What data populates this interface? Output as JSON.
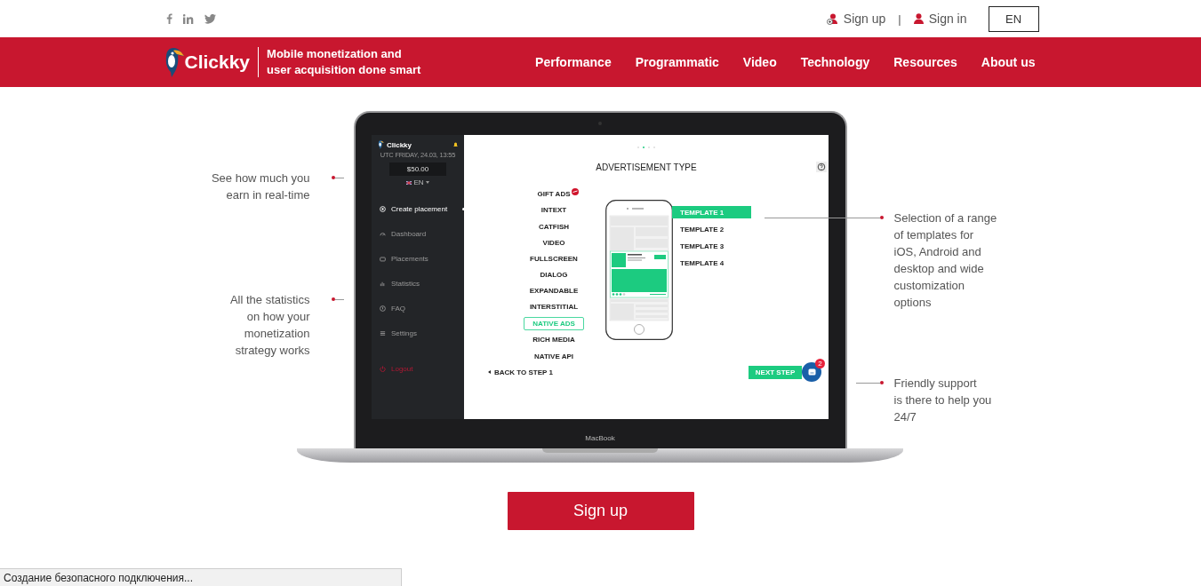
{
  "top_bar": {
    "sign_up": "Sign up",
    "separator": "|",
    "sign_in": "Sign in",
    "language": "EN"
  },
  "header": {
    "logo": "Clickky",
    "tagline": [
      "Mobile monetization and",
      "user acquisition done smart"
    ],
    "nav": [
      "Performance",
      "Programmatic",
      "Video",
      "Technology",
      "Resources",
      "About us"
    ]
  },
  "app_screen": {
    "logo": "Clickky",
    "datetime": "UTC FRIDAY, 24.03, 13:55",
    "balance": "$50.00",
    "language": "EN",
    "menu": [
      {
        "label": "Create placement",
        "selected": true,
        "kind": "item"
      },
      {
        "label": "Dashboard",
        "selected": false,
        "kind": "item"
      },
      {
        "label": "Placements",
        "selected": false,
        "kind": "item"
      },
      {
        "label": "Statistics",
        "selected": false,
        "kind": "item"
      },
      {
        "label": "FAQ",
        "selected": false,
        "kind": "item"
      },
      {
        "label": "Settings",
        "selected": false,
        "kind": "item"
      },
      {
        "label": "Logout",
        "selected": false,
        "kind": "logout"
      }
    ],
    "steps": [
      {
        "selected": false
      },
      {
        "selected": true
      },
      {
        "selected": false
      },
      {
        "selected": false
      }
    ],
    "title": "ADVERTISEMENT TYPE",
    "ad_types": [
      {
        "label": "GIFT ADS",
        "selected": false,
        "badge": true
      },
      {
        "label": "INTEXT",
        "selected": false,
        "badge": false
      },
      {
        "label": "CATFISH",
        "selected": false,
        "badge": false
      },
      {
        "label": "VIDEO",
        "selected": false,
        "badge": false
      },
      {
        "label": "FULLSCREEN",
        "selected": false,
        "badge": false
      },
      {
        "label": "DIALOG",
        "selected": false,
        "badge": false
      },
      {
        "label": "EXPANDABLE",
        "selected": false,
        "badge": false
      },
      {
        "label": "INTERSTITIAL",
        "selected": false,
        "badge": false
      },
      {
        "label": "NATIVE ADS",
        "selected": true,
        "badge": false
      },
      {
        "label": "RICH MEDIA",
        "selected": false,
        "badge": false
      },
      {
        "label": "NATIVE API",
        "selected": false,
        "badge": false
      }
    ],
    "templates": [
      {
        "label": "TEMPLATE 1",
        "selected": true
      },
      {
        "label": "TEMPLATE 2",
        "selected": false
      },
      {
        "label": "TEMPLATE 3",
        "selected": false
      },
      {
        "label": "TEMPLATE 4",
        "selected": false
      }
    ],
    "back": "BACK TO STEP 1",
    "next": "NEXT STEP",
    "chat_badge": "2"
  },
  "laptop_label": "MacBook",
  "annotations_left": [
    [
      "See how much you",
      "earn in real-time"
    ],
    [
      "All the statistics",
      "on how your",
      "monetization",
      "strategy works"
    ]
  ],
  "annotations_right": [
    [
      "Selection of a range",
      "of templates for",
      "iOS, Android and",
      "desktop and wide",
      "customization",
      "options"
    ],
    [
      "Friendly support",
      "is there to help you",
      "24/7"
    ]
  ],
  "cta": "Sign up",
  "status_bar": "Создание безопасного подключения..."
}
